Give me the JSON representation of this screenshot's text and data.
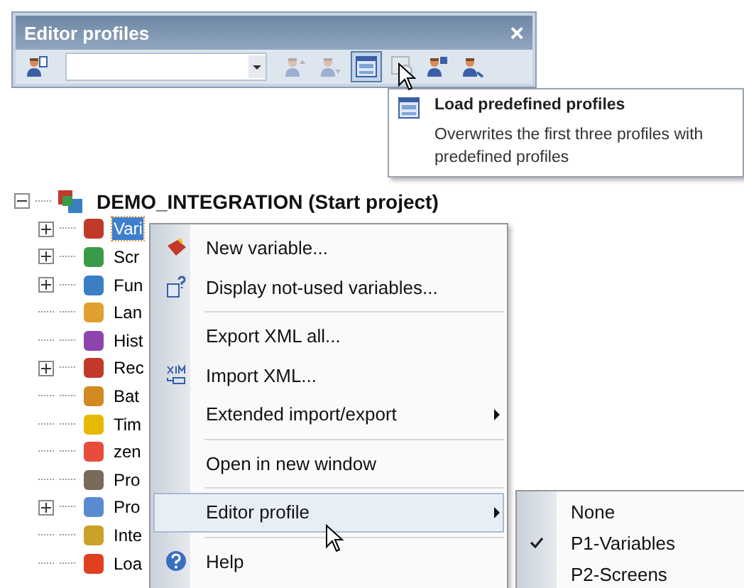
{
  "panel": {
    "title": "Editor profiles",
    "close": "×",
    "toolbar": [
      {
        "kind": "new",
        "disabled": false,
        "selected": false
      },
      {
        "kind": "combo"
      },
      {
        "kind": "up",
        "disabled": true,
        "selected": false
      },
      {
        "kind": "down",
        "disabled": true,
        "selected": false
      },
      {
        "kind": "load",
        "disabled": false,
        "selected": true
      },
      {
        "kind": "remove",
        "disabled": true,
        "selected": false
      },
      {
        "kind": "save",
        "disabled": false,
        "selected": false
      },
      {
        "kind": "rename",
        "disabled": false,
        "selected": false
      }
    ]
  },
  "tooltip": {
    "title": "Load predefined profiles",
    "description": "Overwrites the first three profiles with predefined profiles"
  },
  "tree": {
    "label": "DEMO_INTEGRATION (Start project)",
    "expanded": true,
    "children": [
      {
        "label": "Vari",
        "has_children": true,
        "selected": true
      },
      {
        "label": "Scr",
        "has_children": true,
        "selected": false
      },
      {
        "label": "Fun",
        "has_children": true,
        "selected": false
      },
      {
        "label": "Lan",
        "has_children": false,
        "selected": false
      },
      {
        "label": "Hist",
        "has_children": false,
        "selected": false
      },
      {
        "label": "Rec",
        "has_children": true,
        "selected": false
      },
      {
        "label": "Bat",
        "has_children": false,
        "selected": false
      },
      {
        "label": "Tim",
        "has_children": false,
        "selected": false
      },
      {
        "label": "zen",
        "has_children": false,
        "selected": false
      },
      {
        "label": "Pro",
        "has_children": false,
        "selected": false
      },
      {
        "label": "Pro",
        "has_children": true,
        "selected": false
      },
      {
        "label": "Inte",
        "has_children": false,
        "selected": false
      },
      {
        "label": "Loa",
        "has_children": false,
        "selected": false
      }
    ]
  },
  "context_menu": [
    {
      "kind": "item",
      "label": "New variable...",
      "submenu": false,
      "selected": false
    },
    {
      "kind": "item",
      "label": "Display not-used variables...",
      "submenu": false,
      "selected": false
    },
    {
      "kind": "separator"
    },
    {
      "kind": "item",
      "label": "Export XML all...",
      "submenu": false,
      "selected": false
    },
    {
      "kind": "item",
      "label": "Import XML...",
      "submenu": false,
      "selected": false
    },
    {
      "kind": "item",
      "label": "Extended import/export",
      "submenu": true,
      "selected": false
    },
    {
      "kind": "separator"
    },
    {
      "kind": "item",
      "label": "Open in new window",
      "submenu": false,
      "selected": false
    },
    {
      "kind": "separator"
    },
    {
      "kind": "item",
      "label": "Editor profile",
      "submenu": true,
      "selected": true
    },
    {
      "kind": "separator"
    },
    {
      "kind": "item",
      "label": "Help",
      "submenu": false,
      "selected": false
    }
  ],
  "submenu": [
    {
      "label": "None",
      "checked": false
    },
    {
      "label": "P1-Variables",
      "checked": true
    },
    {
      "label": "P2-Screens",
      "checked": false
    }
  ]
}
